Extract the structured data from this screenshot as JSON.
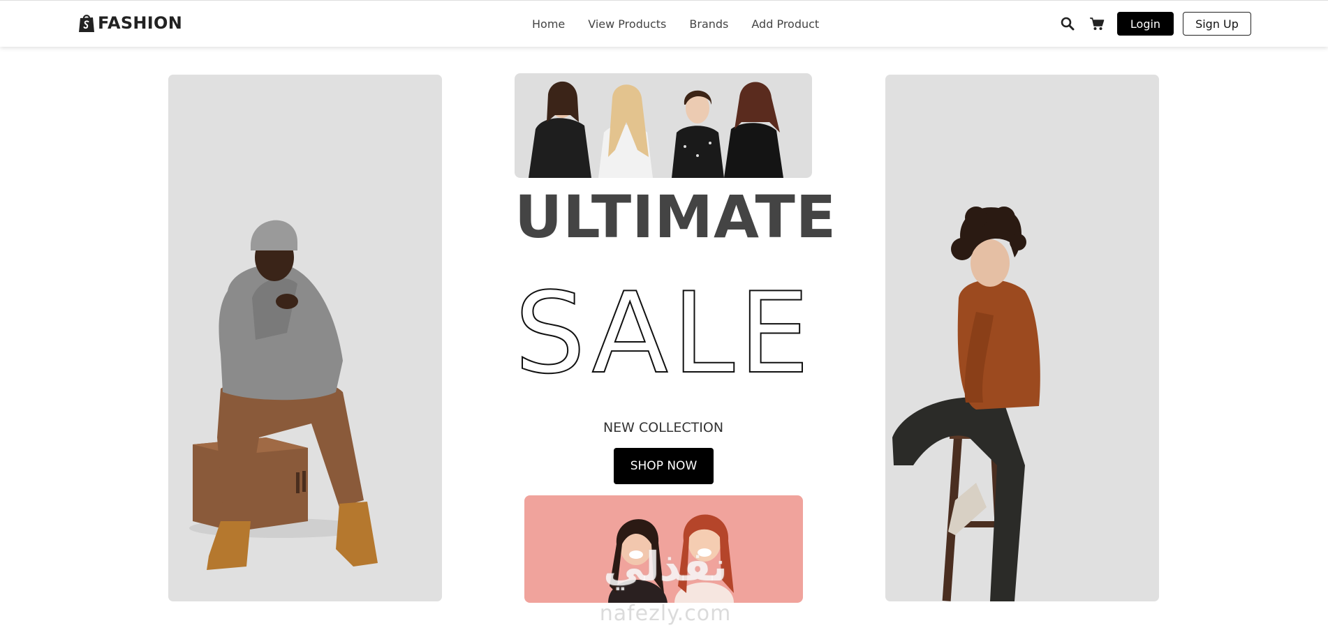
{
  "navbar": {
    "brand": "FASHION",
    "links": [
      "Home",
      "View Products",
      "Brands",
      "Add Product"
    ],
    "login_label": "Login",
    "signup_label": "Sign Up"
  },
  "hero": {
    "headline": "ULTIMATE",
    "sale": "SALE",
    "subheading": "NEW COLLECTION",
    "cta_label": "SHOP NOW"
  },
  "watermark": {
    "arabic": "نفذلي",
    "latin": "nafezly.com"
  },
  "colors": {
    "panel_bg": "#e0e0e0",
    "accent": "#000000",
    "pink_banner": "#f0a39c",
    "headline": "#444444"
  },
  "icons": [
    "shopify-bag-icon",
    "search-icon",
    "cart-icon"
  ]
}
